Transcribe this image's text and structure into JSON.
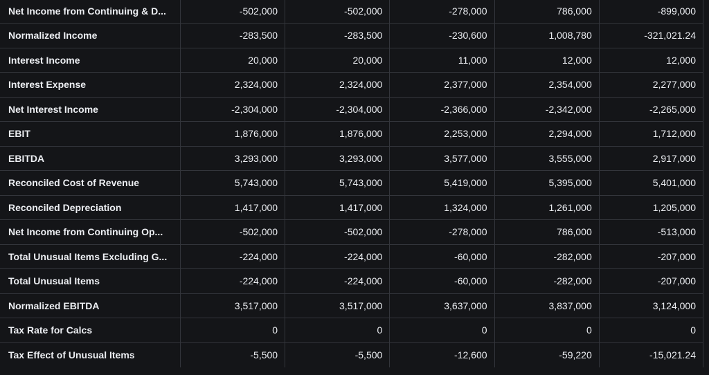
{
  "table": {
    "rows": [
      {
        "label": "Net Income from Continuing & D...",
        "values": [
          "-502,000",
          "-502,000",
          "-278,000",
          "786,000",
          "-899,000"
        ]
      },
      {
        "label": "Normalized Income",
        "values": [
          "-283,500",
          "-283,500",
          "-230,600",
          "1,008,780",
          "-321,021.24"
        ]
      },
      {
        "label": "Interest Income",
        "values": [
          "20,000",
          "20,000",
          "11,000",
          "12,000",
          "12,000"
        ]
      },
      {
        "label": "Interest Expense",
        "values": [
          "2,324,000",
          "2,324,000",
          "2,377,000",
          "2,354,000",
          "2,277,000"
        ]
      },
      {
        "label": "Net Interest Income",
        "values": [
          "-2,304,000",
          "-2,304,000",
          "-2,366,000",
          "-2,342,000",
          "-2,265,000"
        ]
      },
      {
        "label": "EBIT",
        "values": [
          "1,876,000",
          "1,876,000",
          "2,253,000",
          "2,294,000",
          "1,712,000"
        ]
      },
      {
        "label": "EBITDA",
        "values": [
          "3,293,000",
          "3,293,000",
          "3,577,000",
          "3,555,000",
          "2,917,000"
        ]
      },
      {
        "label": "Reconciled Cost of Revenue",
        "values": [
          "5,743,000",
          "5,743,000",
          "5,419,000",
          "5,395,000",
          "5,401,000"
        ]
      },
      {
        "label": "Reconciled Depreciation",
        "values": [
          "1,417,000",
          "1,417,000",
          "1,324,000",
          "1,261,000",
          "1,205,000"
        ]
      },
      {
        "label": "Net Income from Continuing Op...",
        "values": [
          "-502,000",
          "-502,000",
          "-278,000",
          "786,000",
          "-513,000"
        ]
      },
      {
        "label": "Total Unusual Items Excluding G...",
        "values": [
          "-224,000",
          "-224,000",
          "-60,000",
          "-282,000",
          "-207,000"
        ]
      },
      {
        "label": "Total Unusual Items",
        "values": [
          "-224,000",
          "-224,000",
          "-60,000",
          "-282,000",
          "-207,000"
        ]
      },
      {
        "label": "Normalized EBITDA",
        "values": [
          "3,517,000",
          "3,517,000",
          "3,637,000",
          "3,837,000",
          "3,124,000"
        ]
      },
      {
        "label": "Tax Rate for Calcs",
        "values": [
          "0",
          "0",
          "0",
          "0",
          "0"
        ]
      },
      {
        "label": "Tax Effect of Unusual Items",
        "values": [
          "-5,500",
          "-5,500",
          "-12,600",
          "-59,220",
          "-15,021.24"
        ]
      }
    ]
  },
  "colors": {
    "background": "#141518",
    "grid_line": "#33353b",
    "text": "#eceef2"
  }
}
